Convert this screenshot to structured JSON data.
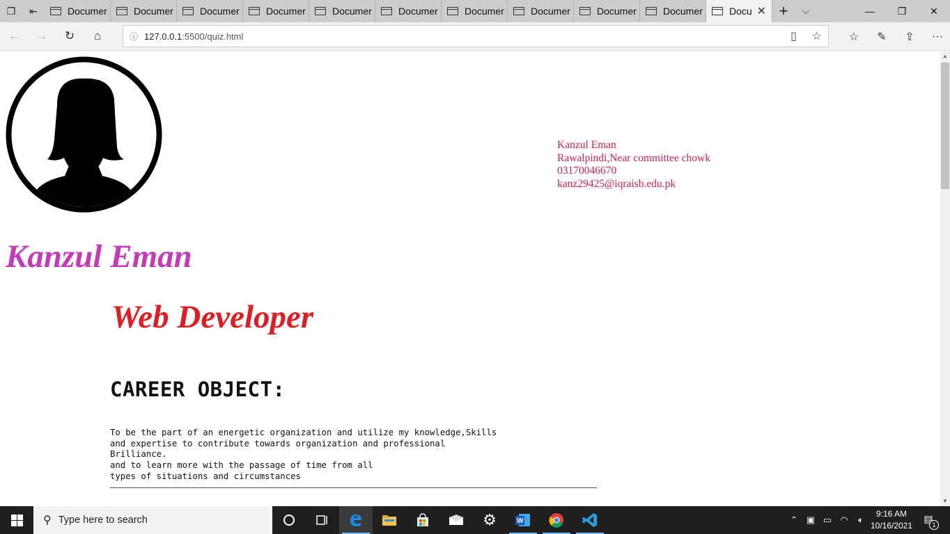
{
  "browser": {
    "tabs": [
      {
        "label": "Documer"
      },
      {
        "label": "Documer"
      },
      {
        "label": "Documer"
      },
      {
        "label": "Documer"
      },
      {
        "label": "Documer"
      },
      {
        "label": "Documer"
      },
      {
        "label": "Documer"
      },
      {
        "label": "Documer"
      },
      {
        "label": "Documer"
      },
      {
        "label": "Documer"
      }
    ],
    "active_tab": {
      "label": "Docu"
    },
    "url_host": "127.0.0.1",
    "url_rest": ":5500/quiz.html"
  },
  "page": {
    "contact": {
      "name": "Kanzul Eman",
      "address": "Rawalpindi,Near committee chowk",
      "phone": "03170046670",
      "email": "kanz29425@iqraisb.edu.pk"
    },
    "name_heading": "Kanzul Eman",
    "role_heading": "Web Developer",
    "career_title": "CAREER OBJECT:",
    "career_text": "To be the part of an energetic organization and utilize my knowledge,Skills\nand expertise to contribute towards organization and professional\nBrilliance.\nand to learn more with the passage of time from all\ntypes of situations and circumstances"
  },
  "taskbar": {
    "search_placeholder": "Type here to search",
    "time": "9:16 AM",
    "date": "10/16/2021",
    "notification_count": "1"
  },
  "colors": {
    "contact": "#d6204e",
    "name": "#c43ab8",
    "role": "#e11d24"
  }
}
